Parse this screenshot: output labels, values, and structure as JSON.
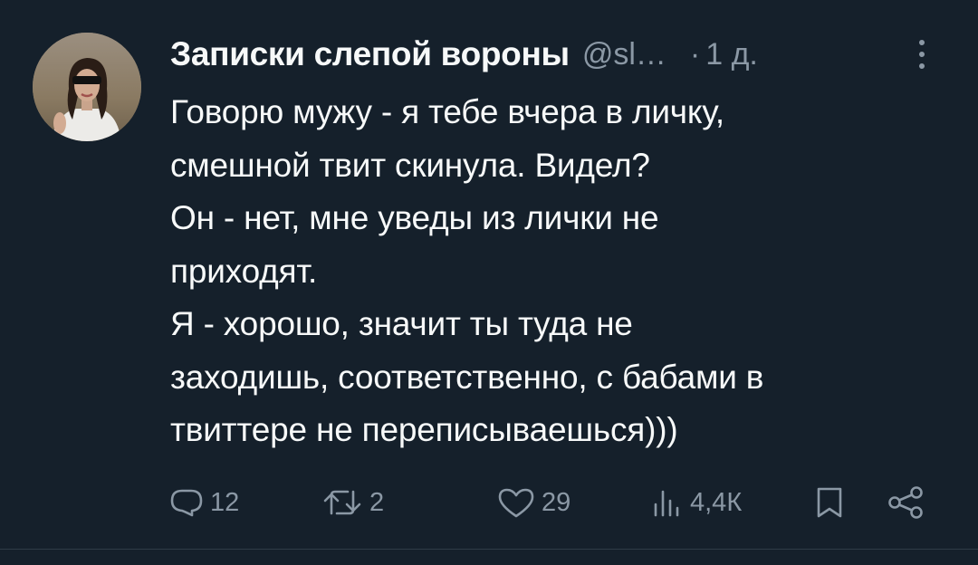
{
  "tweet": {
    "author_name": "Записки слепой вороны",
    "handle": "@sl…",
    "separator": "·",
    "time": "1 д.",
    "lines": [
      "Говорю мужу - я тебе вчера в личку,",
      "смешной твит скинула. Видел?",
      "Он - нет, мне уведы из лички не",
      "приходят.",
      "Я - хорошо, значит ты туда не",
      "заходишь, соответственно, с бабами в",
      "твиттере не переписываешься)))"
    ],
    "actions": {
      "replies": "12",
      "retweets": "2",
      "likes": "29",
      "views": "4,4К"
    }
  },
  "icons": {
    "reply": "reply-icon",
    "retweet": "retweet-icon",
    "like": "heart-icon",
    "views": "views-icon",
    "bookmark": "bookmark-icon",
    "share": "share-icon",
    "more": "more-icon"
  },
  "colors": {
    "background": "#15202b",
    "text": "#f7f9f9",
    "secondary": "#8b98a5"
  }
}
